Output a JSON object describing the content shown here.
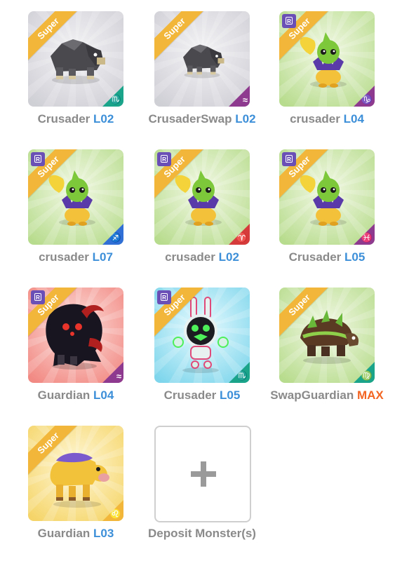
{
  "colors": {
    "level_blue": "#3c8fd8",
    "level_max_orange": "#f26522",
    "name_gray": "#8a8a8a",
    "ribbon_gold": "#f2b73a",
    "rarity_purple": "#6a4fb6"
  },
  "monsters": [
    {
      "name": "Crusader",
      "level": "L02",
      "ribbon": "Super",
      "rare": false,
      "bg": "gray",
      "zodiac": "♏",
      "zodiac_color": "#1aa58a",
      "monster_icon": "rock-boar-icon"
    },
    {
      "name": "CrusaderSwap",
      "level": "L02",
      "ribbon": "Super",
      "rare": false,
      "bg": "gray",
      "zodiac": "≈",
      "zodiac_color": "#8e3a8e",
      "monster_icon": "rock-boar-icon"
    },
    {
      "name": "crusader",
      "level": "L04",
      "ribbon": "Super",
      "rare": true,
      "rare_letter": "R",
      "bg": "green",
      "zodiac": "♑",
      "zodiac_color": "#8e3a8e",
      "monster_icon": "leaf-sprout-icon"
    },
    {
      "name": "crusader",
      "level": "L07",
      "ribbon": "Super",
      "rare": true,
      "rare_letter": "R",
      "bg": "green",
      "zodiac": "♐",
      "zodiac_color": "#2f6fd6",
      "monster_icon": "leaf-sprout-icon"
    },
    {
      "name": "crusader",
      "level": "L02",
      "ribbon": "Super",
      "rare": true,
      "rare_letter": "R",
      "bg": "green",
      "zodiac": "♈",
      "zodiac_color": "#d63b3b",
      "monster_icon": "leaf-sprout-icon"
    },
    {
      "name": "Crusader",
      "level": "L05",
      "ribbon": "Super",
      "rare": true,
      "rare_letter": "R",
      "bg": "green",
      "zodiac": "♓",
      "zodiac_color": "#8e3a8e",
      "monster_icon": "leaf-sprout-icon"
    },
    {
      "name": "Guardian",
      "level": "L04",
      "ribbon": "Super",
      "rare": true,
      "rare_letter": "R",
      "bg": "red",
      "zodiac": "≈",
      "zodiac_color": "#8e3a8e",
      "monster_icon": "shadow-beast-icon"
    },
    {
      "name": "Crusader",
      "level": "L05",
      "ribbon": "Super",
      "rare": true,
      "rare_letter": "R",
      "bg": "cyan",
      "zodiac": "♏",
      "zodiac_color": "#1aa58a",
      "monster_icon": "robot-bunny-icon"
    },
    {
      "name": "SwapGuardian",
      "level": "MAX",
      "ribbon": "Super",
      "rare": false,
      "bg": "green",
      "zodiac": "♍",
      "zodiac_color": "#1aa58a",
      "monster_icon": "mossy-turtle-icon"
    },
    {
      "name": "Guardian",
      "level": "L03",
      "ribbon": "Super",
      "rare": false,
      "bg": "yellow",
      "zodiac": "♌",
      "zodiac_color": "#f2b73a",
      "monster_icon": "golden-bull-icon"
    }
  ],
  "deposit": {
    "label": "Deposit Monster(s)"
  }
}
